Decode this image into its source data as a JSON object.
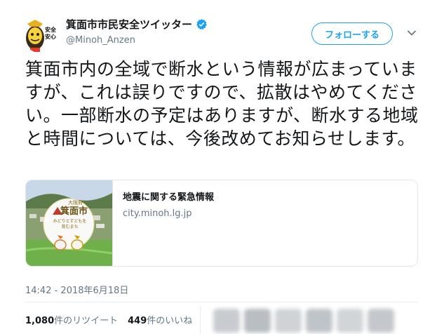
{
  "account": {
    "display_name": "箕面市市民安全ツイッター",
    "handle": "@Minoh_Anzen",
    "avatar_text": [
      "安全",
      "安心"
    ],
    "verified": true
  },
  "header": {
    "follow_label": "フォローする",
    "menu_icon": "chevron-down-icon"
  },
  "tweet": {
    "text": "箕面市内の全域で断水という情報が広まっていますが、これは誤りですので、拡散はやめてください。一部断水の予定はありますが、断水する地域と時間については、今後改めてお知らせします。",
    "timestamp": "14:42 - 2018年6月18日"
  },
  "card": {
    "title": "地震に関する緊急情報",
    "domain": "city.minoh.lg.jp",
    "thumb_lines": [
      "大阪府",
      "箕面市",
      "みどりとすどもを",
      "育むまち"
    ]
  },
  "stats": {
    "retweets_count": "1,080",
    "retweets_label": "件のリツイート",
    "likes_count": "449",
    "likes_label": "件のいいね"
  },
  "colors": {
    "accent": "#1da1f2",
    "text": "#14171a",
    "muted": "#657786",
    "border": "#e1e8ed"
  }
}
